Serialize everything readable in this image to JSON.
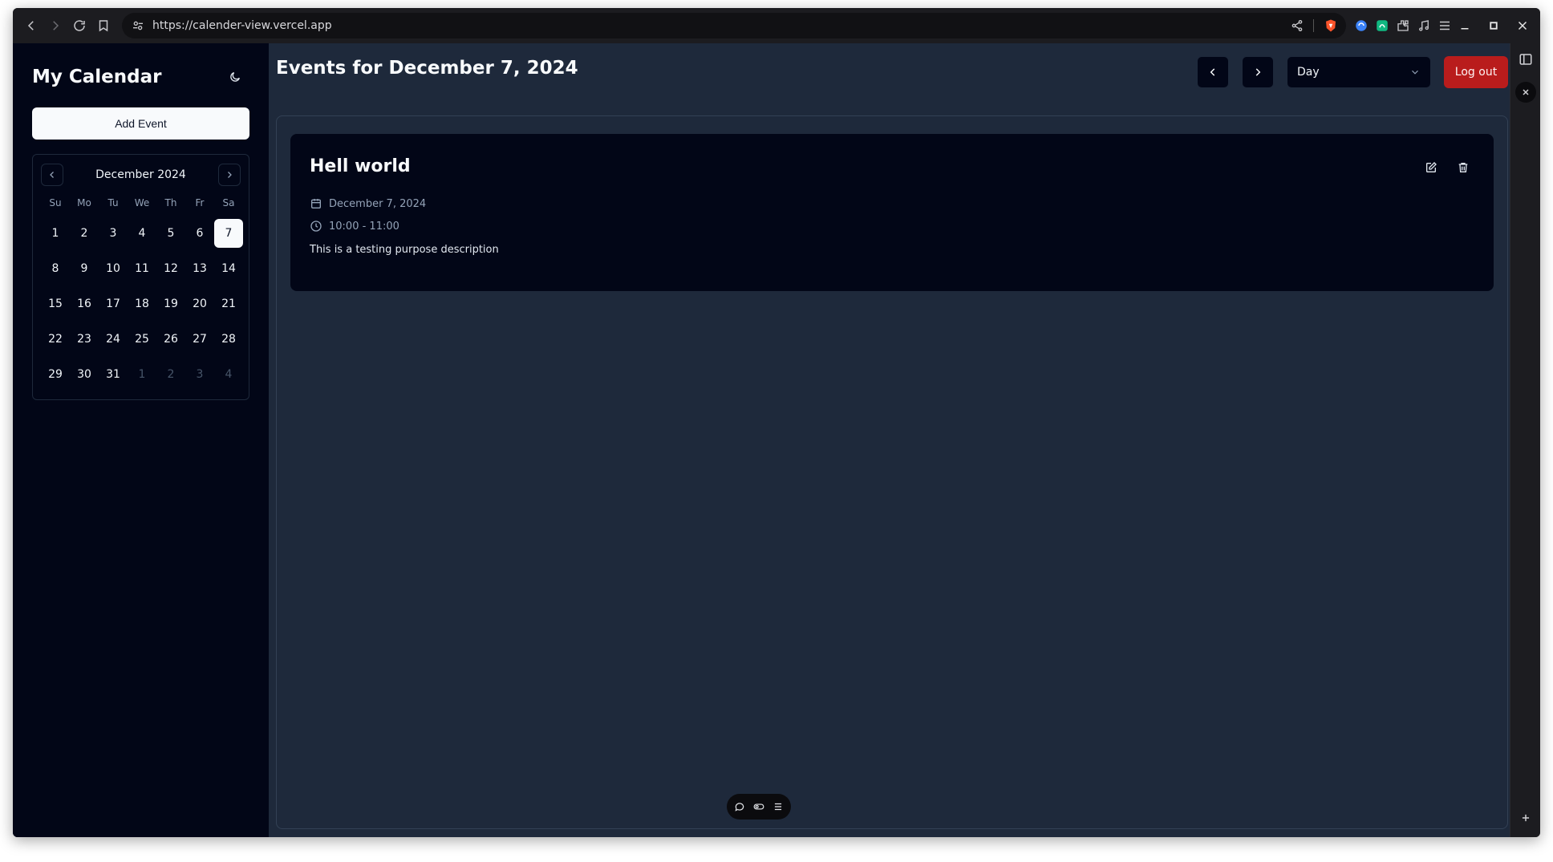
{
  "browser": {
    "url": "https://calender-view.vercel.app"
  },
  "sidebar": {
    "title": "My Calendar",
    "add_event_label": "Add Event"
  },
  "calendar": {
    "month_label": "December 2024",
    "weekdays": [
      "Su",
      "Mo",
      "Tu",
      "We",
      "Th",
      "Fr",
      "Sa"
    ],
    "weeks": [
      [
        "1",
        "2",
        "3",
        "4",
        "5",
        "6",
        "7"
      ],
      [
        "8",
        "9",
        "10",
        "11",
        "12",
        "13",
        "14"
      ],
      [
        "15",
        "16",
        "17",
        "18",
        "19",
        "20",
        "21"
      ],
      [
        "22",
        "23",
        "24",
        "25",
        "26",
        "27",
        "28"
      ],
      [
        "29",
        "30",
        "31",
        "1",
        "2",
        "3",
        "4"
      ]
    ],
    "selected_day": "7",
    "outside_days_last_row": [
      "1",
      "2",
      "3",
      "4"
    ]
  },
  "header": {
    "title": "Events for December 7, 2024",
    "view_selected": "Day",
    "logout_label": "Log out"
  },
  "event": {
    "title": "Hell world",
    "date": "December 7, 2024",
    "time": "10:00 - 11:00",
    "description": "This is a testing purpose description"
  },
  "colors": {
    "sidebar_bg": "#020617",
    "main_bg": "#1e293b",
    "logout_bg": "#b91c1c",
    "selected_day_bg": "#f8fafc"
  }
}
